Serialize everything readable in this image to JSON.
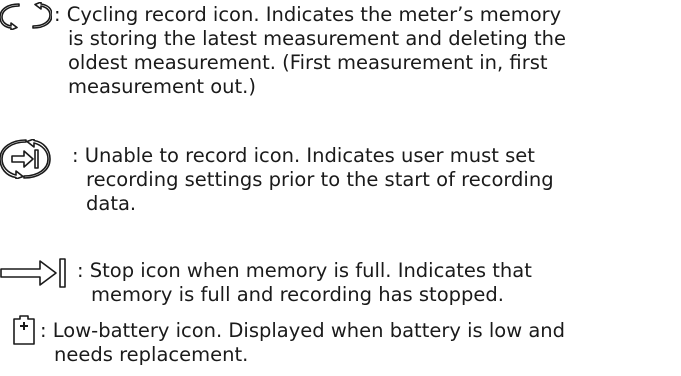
{
  "entries": [
    {
      "icon": "cycling-record-icon",
      "lines": [
        ": Cycling record icon. Indicates the meter’s memory",
        "is storing the latest measurement and deleting the",
        "oldest measurement. (First measurement in, first",
        "measurement out.)"
      ]
    },
    {
      "icon": "unable-to-record-icon",
      "lines": [
        ": Unable to record icon. Indicates user must set",
        "recording settings prior to the start of recording",
        "data."
      ]
    },
    {
      "icon": "stop-memory-full-icon",
      "lines": [
        ": Stop icon when memory is full. Indicates that",
        "memory is full and recording has stopped."
      ]
    },
    {
      "icon": "low-battery-icon",
      "lines": [
        ": Low-battery icon. Displayed when battery is low and",
        "needs replacement."
      ]
    }
  ]
}
